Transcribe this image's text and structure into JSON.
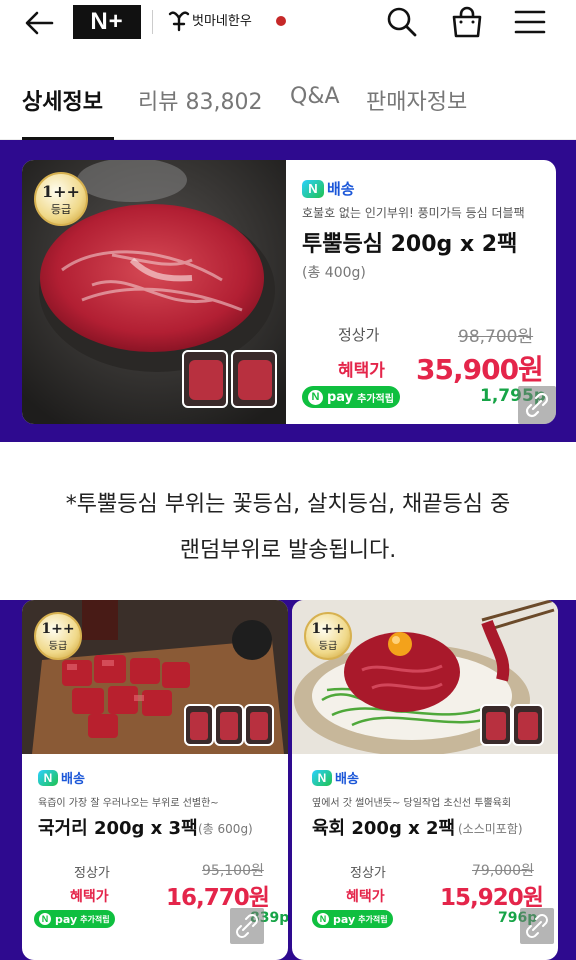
{
  "header": {
    "logo_text": "N+",
    "brand_name": "벗마네한우"
  },
  "tabs": [
    {
      "label": "상세정보"
    },
    {
      "label": "리뷰 83,802"
    },
    {
      "label": "Q&A"
    },
    {
      "label": "판매자정보"
    }
  ],
  "colors": {
    "banner_bg": "#2e0a8f",
    "sale_red": "#e4254a",
    "npay_green": "#0fbf3f",
    "delivery_blue": "#1a56d8"
  },
  "main_product": {
    "grade_top": "1++",
    "grade_bottom": "등급",
    "delivery_label": "배송",
    "subtitle": "호불호 없는 인기부위! 풍미가득 등심 더블팩",
    "title": "투뿔등심 200g x 2팩",
    "total": "(총 400g)",
    "regular_label": "정상가",
    "regular_price": "98,700원",
    "sale_label": "혜택가",
    "sale_price": "35,900원",
    "npay_label": "pay",
    "npay_extra": "추가적립",
    "points": "1,795p"
  },
  "notice": {
    "line1": "*투뿔등심 부위는 꽃등심, 살치등심, 채끝등심 중",
    "line2": "랜덤부위로 발송됩니다."
  },
  "products": [
    {
      "grade_top": "1++",
      "grade_bottom": "등급",
      "delivery_label": "배송",
      "subtitle": "육즙이 가장 잘 우러나오는 부위로 선별한~",
      "title": "국거리 200g x 3팩",
      "total": "(총 600g)",
      "regular_label": "정상가",
      "regular_price": "95,100원",
      "sale_label": "혜택가",
      "sale_price": "16,770원",
      "npay_label": "pay",
      "npay_extra": "추가적립",
      "points": "839p"
    },
    {
      "grade_top": "1++",
      "grade_bottom": "등급",
      "delivery_label": "배송",
      "subtitle": "옆에서 갓 썰어낸듯~ 당일작업 초신선 투뿔육회",
      "title": "육회 200g x 2팩",
      "total": "(소스미포함)",
      "regular_label": "정상가",
      "regular_price": "79,000원",
      "sale_label": "혜택가",
      "sale_price": "15,920원",
      "npay_label": "pay",
      "npay_extra": "추가적립",
      "points": "796p"
    }
  ]
}
